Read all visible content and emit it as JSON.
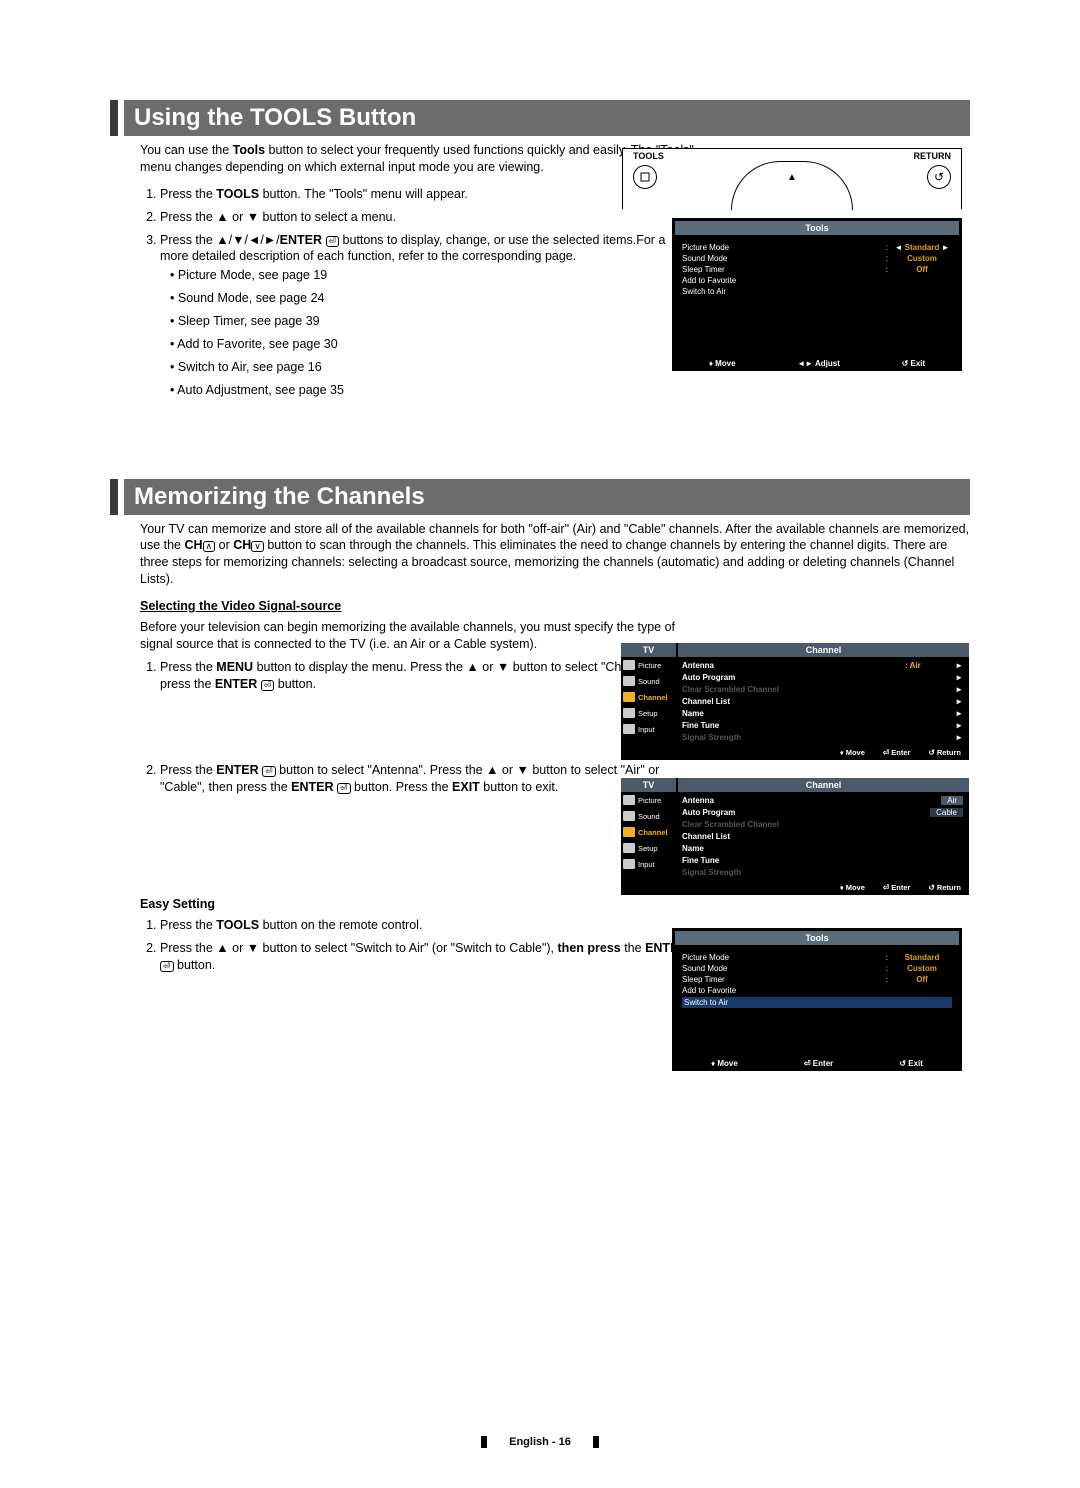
{
  "section1": {
    "heading": "Using the TOOLS Button",
    "intro_part1": "You can use the ",
    "intro_bold": "Tools",
    "intro_part2": " button to select your frequently used functions quickly and easily. The \"Tools\" menu changes depending on which external input mode you are viewing.",
    "steps": {
      "s1a": "Press the ",
      "s1b_bold": "TOOLS",
      "s1c": " button. The \"Tools\" menu will appear.",
      "s2": "Press the ▲ or ▼ button to select a menu.",
      "s3a": "Press the ▲/▼/◄/►/",
      "s3b_bold": "ENTER",
      "s3c": " buttons to display, change, or use the selected items.For a more detailed description of each function, refer to the corresponding page."
    },
    "bullets": [
      "Picture Mode, see page 19",
      "Sound Mode, see page 24",
      "Sleep Timer, see page 39",
      "Add to Favorite, see page 30",
      "Switch to Air, see page 16",
      "Auto Adjustment, see page 35"
    ]
  },
  "remote": {
    "left_label": "TOOLS",
    "right_label": "RETURN",
    "return_symbol": "↺"
  },
  "tools_osd": {
    "title": "Tools",
    "rows": [
      {
        "label": "Picture Mode",
        "sep": ":",
        "val": "Standard",
        "arrows": true
      },
      {
        "label": "Sound Mode",
        "sep": ":",
        "val": "Custom",
        "arrows": false
      },
      {
        "label": "Sleep Timer",
        "sep": ":",
        "val": "Off",
        "arrows": false
      },
      {
        "label": "Add to Favorite",
        "sep": "",
        "val": "",
        "arrows": false
      },
      {
        "label": "Switch to Air",
        "sep": "",
        "val": "",
        "arrows": false
      }
    ],
    "hints": [
      "♦ Move",
      "◄► Adjust",
      "↺ Exit"
    ]
  },
  "section2": {
    "heading": "Memorizing the Channels",
    "intro_a": "Your TV can memorize and store all of the available channels for both \"off-air\" (Air) and \"Cable\" channels. After the available channels are memorized, use the ",
    "intro_b_bold": "CH",
    "intro_c": " or ",
    "intro_d_bold": "CH",
    "intro_e": " button to scan through the channels. This eliminates the need to change channels by entering the channel digits. There are three steps for memorizing channels: selecting a broadcast source, memorizing the channels (automatic) and adding or deleting channels (Channel Lists).",
    "subhead1": "Selecting the Video Signal-source",
    "desc1": "Before your television can begin memorizing the available channels, you must specify the type of signal source that is connected to the TV (i.e. an Air or a Cable system).",
    "step1a": "Press the ",
    "step1b_bold": "MENU",
    "step1c": " button to display the menu. Press the ▲ or ▼ button to select \"Channel\", then press the ",
    "step1d_bold": "ENTER",
    "step1e": " button.",
    "step2a": "Press the ",
    "step2b_bold": "ENTER",
    "step2c": " button to select \"Antenna\". Press the ▲ or ▼ button to select \"Air\" or \"Cable\", then press the ",
    "step2d_bold": "ENTER",
    "step2e": " button. Press the ",
    "step2f_bold": "EXIT",
    "step2g": " button to exit.",
    "subhead2": "Easy Setting",
    "easy1a": "Press the ",
    "easy1b_bold": "TOOLS",
    "easy1c": " button on the remote control.",
    "easy2a": "Press the ▲ or ▼ button to select \"Switch to Air\" (or \"Switch to Cable\"), ",
    "easy2b_bold": "then press",
    "easy2c": " the ",
    "easy2d_bold": "ENTER",
    "easy2e": " button."
  },
  "tvmenu1": {
    "tv": "TV",
    "title": "Channel",
    "side": [
      "Picture",
      "Sound",
      "Channel",
      "Setup",
      "Input"
    ],
    "selected": "Channel",
    "rows": [
      {
        "label": "Antenna",
        "val": ": Air",
        "arrow": "►"
      },
      {
        "label": "Auto Program",
        "val": "",
        "arrow": "►"
      },
      {
        "label": "Clear Scrambled Channel",
        "val": "",
        "arrow": "►",
        "dim": true
      },
      {
        "label": "Channel List",
        "val": "",
        "arrow": "►"
      },
      {
        "label": "Name",
        "val": "",
        "arrow": "►"
      },
      {
        "label": "Fine Tune",
        "val": "",
        "arrow": "►"
      },
      {
        "label": "Signal Strength",
        "val": "",
        "arrow": "►",
        "dim": true
      }
    ],
    "hints": [
      "♦ Move",
      "⏎ Enter",
      "↺ Return"
    ]
  },
  "tvmenu2": {
    "tv": "TV",
    "title": "Channel",
    "side": [
      "Picture",
      "Sound",
      "Channel",
      "Setup",
      "Input"
    ],
    "selected": "Channel",
    "rows": [
      {
        "label": "Antenna",
        "val": "",
        "opt1": "Air",
        "opt2": "Cable"
      },
      {
        "label": "Auto Program",
        "val": ""
      },
      {
        "label": "Clear Scrambled Channel",
        "val": "",
        "dim": true
      },
      {
        "label": "Channel List",
        "val": ""
      },
      {
        "label": "Name",
        "val": ""
      },
      {
        "label": "Fine Tune",
        "val": ""
      },
      {
        "label": "Signal Strength",
        "val": "",
        "dim": true
      }
    ],
    "hints": [
      "♦ Move",
      "⏎ Enter",
      "↺ Return"
    ]
  },
  "tools_osd2": {
    "title": "Tools",
    "rows": [
      {
        "label": "Picture Mode",
        "sep": ":",
        "val": "Standard"
      },
      {
        "label": "Sound Mode",
        "sep": ":",
        "val": "Custom"
      },
      {
        "label": "Sleep Timer",
        "sep": ":",
        "val": "Off"
      },
      {
        "label": "Add to Favorite",
        "sep": "",
        "val": ""
      },
      {
        "label": "Switch to Air",
        "sep": "",
        "val": "",
        "highlight": true
      }
    ],
    "hints": [
      "♦ Move",
      "⏎ Enter",
      "↺ Exit"
    ]
  },
  "footer": "English - 16"
}
